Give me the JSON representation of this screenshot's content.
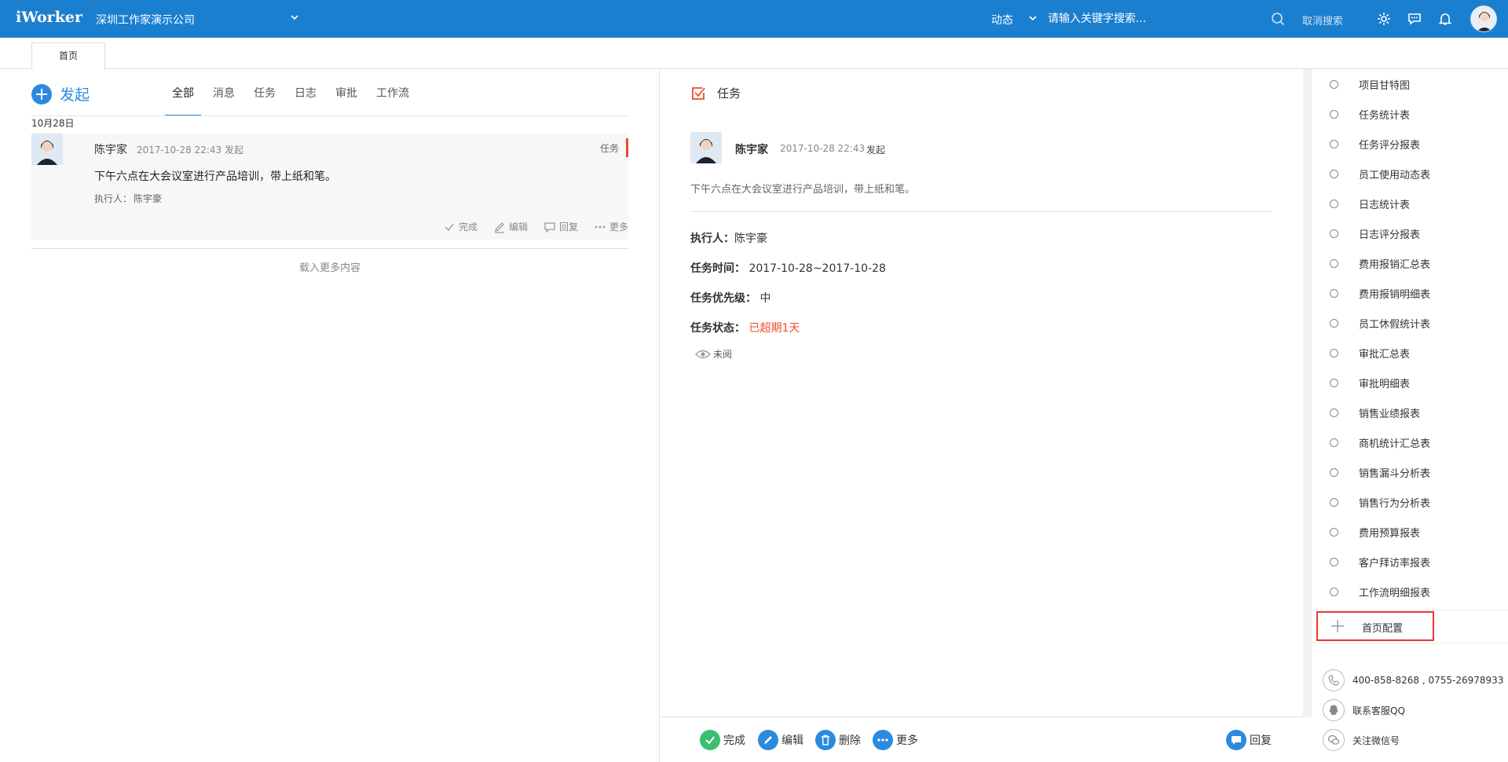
{
  "header": {
    "logo": "iWorker",
    "company": "深圳工作家演示公司",
    "dynamic_label": "动态",
    "search_placeholder": "请输入关键字搜索...",
    "cancel_search": "取消搜索",
    "brand_color": "#1b7fd0"
  },
  "tabs": [
    {
      "label": "首页"
    }
  ],
  "feed": {
    "start_label": "发起",
    "filters": [
      "全部",
      "消息",
      "任务",
      "日志",
      "审批",
      "工作流"
    ],
    "active_filter": "全部",
    "date_header": "10月28日",
    "items": [
      {
        "name": "陈宇家",
        "meta": "2017-10-28 22:43 发起",
        "type": "任务",
        "content": "下午六点在大会议室进行产品培训，带上纸和笔。",
        "executor_label": "执行人：",
        "executor": "陈宇豪",
        "actions": [
          "完成",
          "编辑",
          "回复",
          "更多"
        ]
      }
    ],
    "load_more": "载入更多内容"
  },
  "detail": {
    "title": "任务",
    "name": "陈宇家",
    "time": "2017-10-28 22:43",
    "action": "发起",
    "content": "下午六点在大会议室进行产品培训，带上纸和笔。",
    "executor_label": "执行人：",
    "executor": "陈宇豪",
    "time_label": "任务时间：",
    "time_range": "2017-10-28~2017-10-28",
    "priority_label": "任务优先级：",
    "priority": "中",
    "status_label": "任务状态：",
    "status": "已超期1天",
    "status_color": "#ef4b2a",
    "unread": "未阅",
    "footer_actions": [
      "完成",
      "编辑",
      "删除",
      "更多"
    ],
    "reply": "回复"
  },
  "reports": [
    "项目甘特图",
    "任务统计表",
    "任务评分报表",
    "员工使用动态表",
    "日志统计表",
    "日志评分报表",
    "费用报销汇总表",
    "费用报销明细表",
    "员工休假统计表",
    "审批汇总表",
    "审批明细表",
    "销售业绩报表",
    "商机统计汇总表",
    "销售漏斗分析表",
    "销售行为分析表",
    "费用预算报表",
    "客户拜访率报表",
    "工作流明细报表"
  ],
  "config_label": "首页配置",
  "contacts": {
    "phone": "400-858-8268 , 0755-26978933",
    "qq": "联系客服QQ",
    "wechat": "关注微信号"
  }
}
